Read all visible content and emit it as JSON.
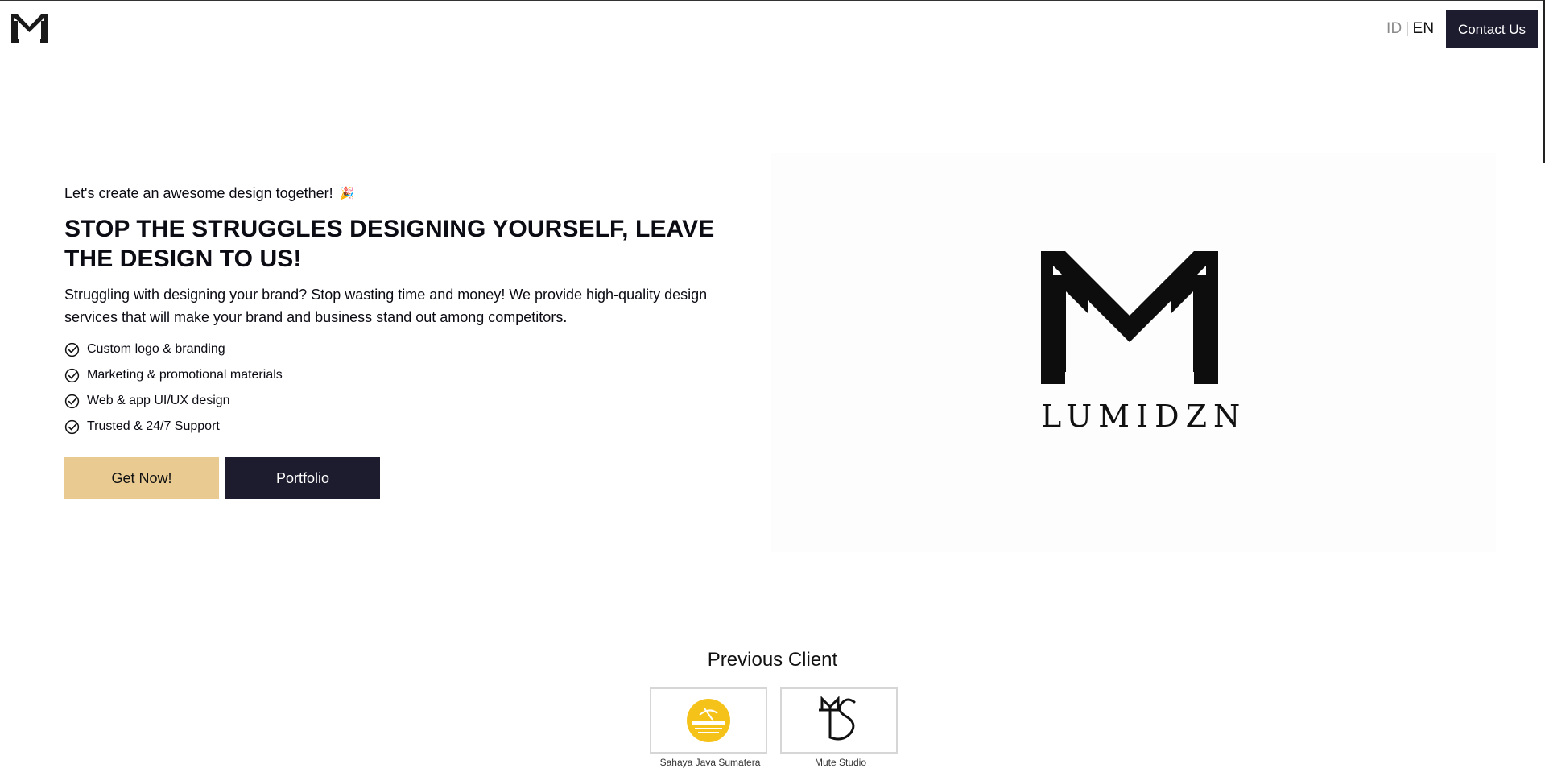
{
  "header": {
    "lang_id": "ID",
    "lang_sep": "|",
    "lang_en": "EN",
    "contact_label": "Contact Us"
  },
  "hero": {
    "kicker": "Let's create an awesome design together!",
    "headline": "STOP THE STRUGGLES DESIGNING YOURSELF, LEAVE THE DESIGN TO US!",
    "description": "Struggling with designing your brand? Stop wasting time and money! We provide high-quality design services that will make your brand and business stand out among competitors.",
    "features": [
      "Custom logo & branding",
      "Marketing & promotional materials",
      "Web & app UI/UX design",
      "Trusted & 24/7 Support"
    ],
    "primary_button": "Get Now!",
    "secondary_button": "Portfolio",
    "brand_name": "LUMIDZN"
  },
  "clients": {
    "title": "Previous Client",
    "items": [
      {
        "name": "Sahaya Java Sumatera"
      },
      {
        "name": "Mute Studio"
      }
    ]
  },
  "colors": {
    "dark": "#1d1b2e",
    "accent": "#e9cb92",
    "client_badge": "#f5c21a"
  },
  "icons": [
    "brand-logo-icon",
    "party-popper-icon",
    "check-circle-icon"
  ]
}
